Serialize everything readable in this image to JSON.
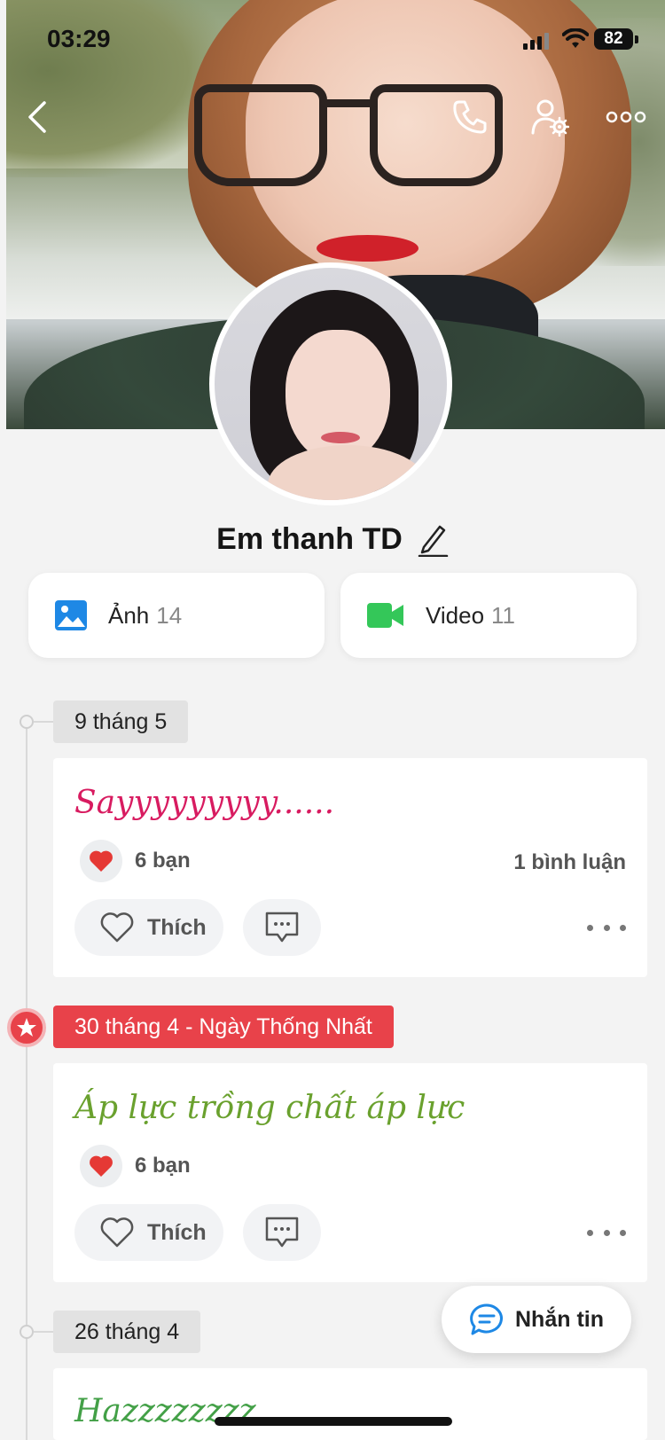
{
  "status_bar": {
    "time": "03:29",
    "battery": "82"
  },
  "profile": {
    "name": "Em thanh TD"
  },
  "media": {
    "photos": {
      "label": "Ảnh",
      "count": "14"
    },
    "videos": {
      "label": "Video",
      "count": "11"
    }
  },
  "timeline": [
    {
      "date": "9 tháng 5",
      "holiday": false,
      "post": {
        "text": "Sayyyyyyyyy......",
        "text_color": "#d81b60",
        "reactions": "6 bạn",
        "comments": "1 bình luận",
        "like_label": "Thích"
      }
    },
    {
      "date": "30 tháng 4 - Ngày Thống Nhất",
      "holiday": true,
      "post": {
        "text": "Áp lực trồng chất áp lực",
        "text_color": "#6aa12e",
        "reactions": "6 bạn",
        "comments": "",
        "like_label": "Thích"
      }
    },
    {
      "date": "26 tháng 4",
      "holiday": false,
      "post": {
        "text": "Hazzzzzzzz",
        "text_color": "#43a047"
      }
    }
  ],
  "fab": {
    "label": "Nhắn tin"
  },
  "colors": {
    "accent_blue": "#1e88e5",
    "video_green": "#34c759",
    "holiday_red": "#e8424a",
    "heart_red": "#e53935"
  }
}
